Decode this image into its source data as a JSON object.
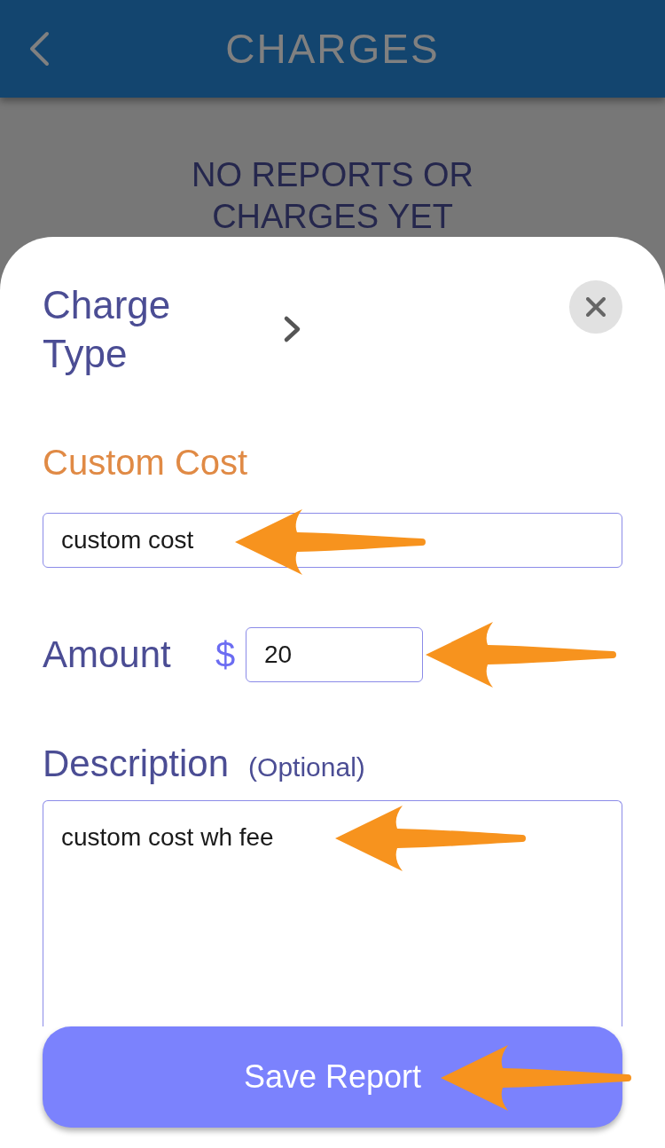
{
  "header": {
    "title": "CHARGES"
  },
  "empty_state": {
    "message": "NO REPORTS OR CHARGES YET"
  },
  "sheet": {
    "charge_type": {
      "label": "Charge Type"
    },
    "section_title": "Custom Cost",
    "name_field": {
      "value": "custom cost",
      "callout": true
    },
    "amount": {
      "label": "Amount",
      "currency": "$",
      "value": "20",
      "callout": true
    },
    "description": {
      "label": "Description",
      "note": "(Optional)",
      "value": "custom cost wh fee",
      "callout": true
    },
    "save_button": {
      "label": "Save Report",
      "callout": true
    }
  }
}
